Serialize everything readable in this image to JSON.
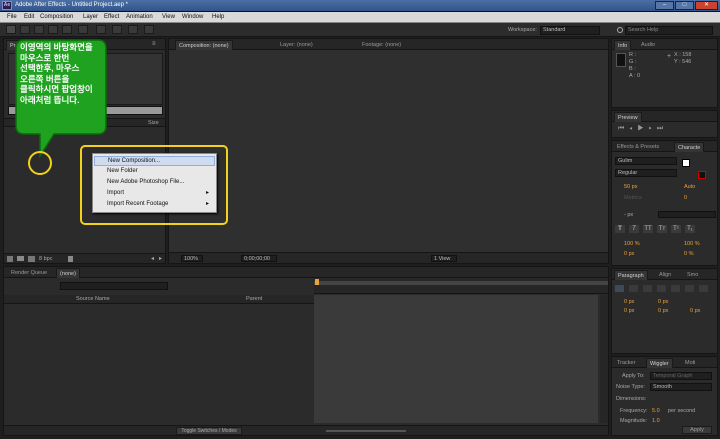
{
  "window": {
    "title": "Adobe After Effects - Untitled Project.aep *",
    "logo": "Ae",
    "controls": [
      "–",
      "□",
      "✕"
    ]
  },
  "menu": [
    "File",
    "Edit",
    "Composition",
    "Layer",
    "Effect",
    "Animation",
    "View",
    "Window",
    "Help"
  ],
  "toolbar": {
    "workspace_label": "Workspace:",
    "workspace_value": "Standard",
    "search_placeholder": "Search Help"
  },
  "project_panel": {
    "tab": "Project",
    "col_size": "Size",
    "bpc": "8 bpc"
  },
  "callout": {
    "text": "이영역의 바탕화면을 마우스로 한번 선택한후, 마우스 오른쪽 버튼을 클릭하시면 팝업창이 아래처럼 뜹니다."
  },
  "context_menu": {
    "items": [
      {
        "label": "New Composition...",
        "arrow": ""
      },
      {
        "label": "New Folder",
        "arrow": ""
      },
      {
        "label": "New Adobe Photoshop File...",
        "arrow": ""
      },
      {
        "label": "Import",
        "arrow": "▸"
      },
      {
        "label": "Import Recent Footage",
        "arrow": "▸"
      }
    ]
  },
  "viewer": {
    "tabs": [
      "Composition: (none)",
      "Layer: (none)",
      "Footage: (none)"
    ],
    "zoom": "100%",
    "timecode": "0;00;00;00",
    "view_mode": "1 View"
  },
  "info_panel": {
    "tabs": [
      "Info",
      "Audio"
    ],
    "r": "R :",
    "g": "G :",
    "b": "B :",
    "a": "A : 0",
    "x": "X : 158",
    "y": "Y : 546"
  },
  "preview_panel": {
    "tab": "Preview"
  },
  "effects_panel": {
    "tabs": [
      "Effects & Presets",
      "Characte"
    ]
  },
  "character_panel": {
    "font": "Gulim",
    "style": "Regular",
    "size": "50 px",
    "leading": "Auto",
    "kerning": "Metrics",
    "tracking": "0",
    "stroke_unit": "- px",
    "vscale": "100 %",
    "hscale": "100 %",
    "baseline": "0 px",
    "tsume": "0 %",
    "styles": [
      "T",
      "T",
      "TT",
      "Tт",
      "T¹",
      "T₁"
    ]
  },
  "paragraph_panel": {
    "tabs": [
      "Paragraph",
      "Align",
      "Smo"
    ],
    "indent_a": "0 px",
    "indent_b": "0 px",
    "indent_c": "0 px",
    "space_a": "0 px",
    "space_b": "0 px"
  },
  "wiggler_panel": {
    "tabs": [
      "Tracker",
      "Wiggler",
      "Moti"
    ],
    "apply_to_label": "Apply To:",
    "apply_to_value": "Temporal Graph",
    "noise_type_label": "Noise Type:",
    "noise_type_value": "Smooth",
    "dimensions_label": "Dimensions:",
    "frequency_label": "Frequency:",
    "frequency_value": "5.0",
    "frequency_unit": "per second",
    "magnitude_label": "Magnitude:",
    "magnitude_value": "1.0",
    "apply_button": "Apply"
  },
  "timeline": {
    "tabs": [
      "Render Queue",
      "(none)"
    ],
    "col_source": "Source Name",
    "col_parent": "Parent",
    "toggle_label": "Toggle Switches / Modes"
  },
  "colors": {
    "highlight_box": "#f2d21b",
    "callout_green": "#1fa21f",
    "accent_orange": "#e8a33a",
    "menu_hover": "#3d64a3"
  }
}
